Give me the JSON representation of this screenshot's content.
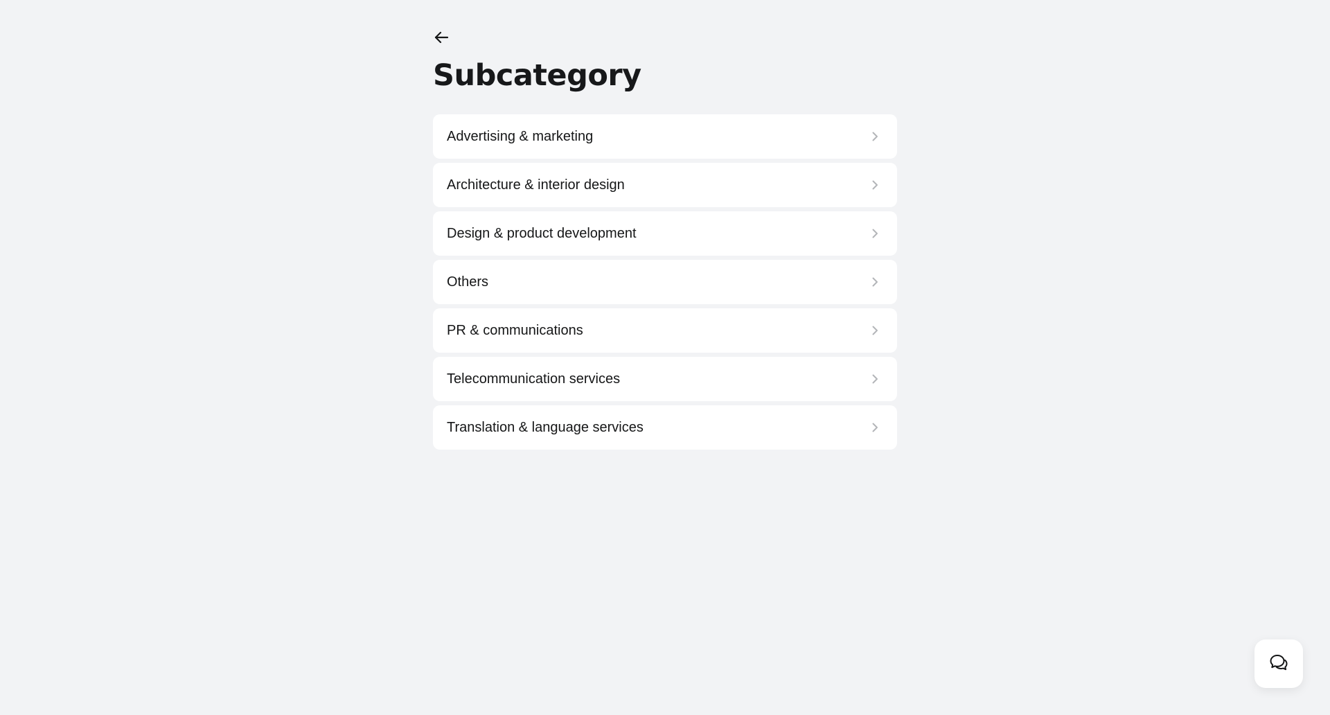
{
  "header": {
    "back_icon": "arrow-left-icon",
    "title": "Subcategory"
  },
  "subcategories": [
    {
      "label": "Advertising & marketing",
      "icon": "chevron-right-icon"
    },
    {
      "label": "Architecture & interior design",
      "icon": "chevron-right-icon"
    },
    {
      "label": "Design & product development",
      "icon": "chevron-right-icon"
    },
    {
      "label": "Others",
      "icon": "chevron-right-icon"
    },
    {
      "label": "PR & communications",
      "icon": "chevron-right-icon"
    },
    {
      "label": "Telecommunication services",
      "icon": "chevron-right-icon"
    },
    {
      "label": "Translation & language services",
      "icon": "chevron-right-icon"
    }
  ],
  "chat": {
    "icon": "chat-bubbles-icon"
  },
  "colors": {
    "background": "#f2f3f5",
    "card": "#ffffff",
    "text": "#151617",
    "chevron": "#b3b5b8"
  }
}
